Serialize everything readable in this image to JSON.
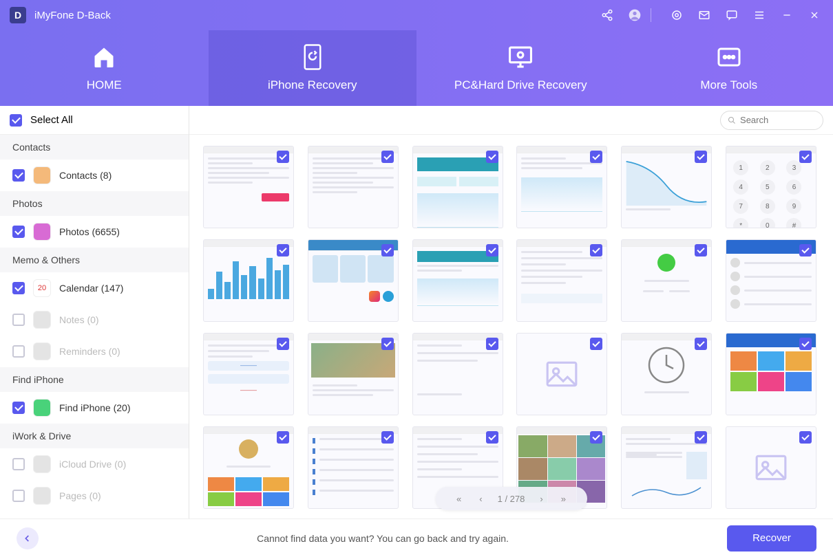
{
  "app": {
    "title": "iMyFone D-Back"
  },
  "tabs": [
    {
      "label": "HOME"
    },
    {
      "label": "iPhone Recovery"
    },
    {
      "label": "PC&Hard Drive Recovery"
    },
    {
      "label": "More Tools"
    }
  ],
  "select_all": "Select All",
  "sidebar": {
    "sections": [
      {
        "title": "Contacts",
        "items": [
          {
            "label": "Contacts (8)",
            "checked": true,
            "enabled": true,
            "iconColor": "#f4b97a"
          }
        ]
      },
      {
        "title": "Photos",
        "items": [
          {
            "label": "Photos (6655)",
            "checked": true,
            "enabled": true,
            "iconColor": "#d86bd4"
          }
        ]
      },
      {
        "title": "Memo & Others",
        "items": [
          {
            "label": "Calendar (147)",
            "checked": true,
            "enabled": true,
            "iconColor": "#ffffff",
            "iconText": "20"
          },
          {
            "label": "Notes (0)",
            "checked": false,
            "enabled": false,
            "iconColor": "#e4e4e4"
          },
          {
            "label": "Reminders (0)",
            "checked": false,
            "enabled": false,
            "iconColor": "#e4e4e4"
          }
        ]
      },
      {
        "title": "Find iPhone",
        "items": [
          {
            "label": "Find iPhone (20)",
            "checked": true,
            "enabled": true,
            "iconColor": "#49d27a"
          }
        ]
      },
      {
        "title": "iWork & Drive",
        "items": [
          {
            "label": "iCloud Drive (0)",
            "checked": false,
            "enabled": false,
            "iconColor": "#e4e4e4"
          },
          {
            "label": "Pages (0)",
            "checked": false,
            "enabled": false,
            "iconColor": "#e4e4e4"
          }
        ]
      }
    ]
  },
  "search": {
    "placeholder": "Search"
  },
  "pager": {
    "current": 1,
    "total": 278,
    "label": "1 / 278"
  },
  "footer": {
    "message": "Cannot find data you want? You can go back and try again.",
    "recover": "Recover"
  },
  "thumbs": [
    {
      "kind": "lines-pink"
    },
    {
      "kind": "lines-grey"
    },
    {
      "kind": "chart-teal"
    },
    {
      "kind": "chart-line"
    },
    {
      "kind": "chart-curve"
    },
    {
      "kind": "keypad"
    },
    {
      "kind": "bars"
    },
    {
      "kind": "telegram"
    },
    {
      "kind": "chart-teal2"
    },
    {
      "kind": "text-block"
    },
    {
      "kind": "profile"
    },
    {
      "kind": "social"
    },
    {
      "kind": "chat"
    },
    {
      "kind": "photo"
    },
    {
      "kind": "backup"
    },
    {
      "kind": "placeholder"
    },
    {
      "kind": "clock"
    },
    {
      "kind": "game"
    },
    {
      "kind": "profile2"
    },
    {
      "kind": "settings"
    },
    {
      "kind": "arabic"
    },
    {
      "kind": "gallery"
    },
    {
      "kind": "stats"
    },
    {
      "kind": "placeholder"
    }
  ]
}
